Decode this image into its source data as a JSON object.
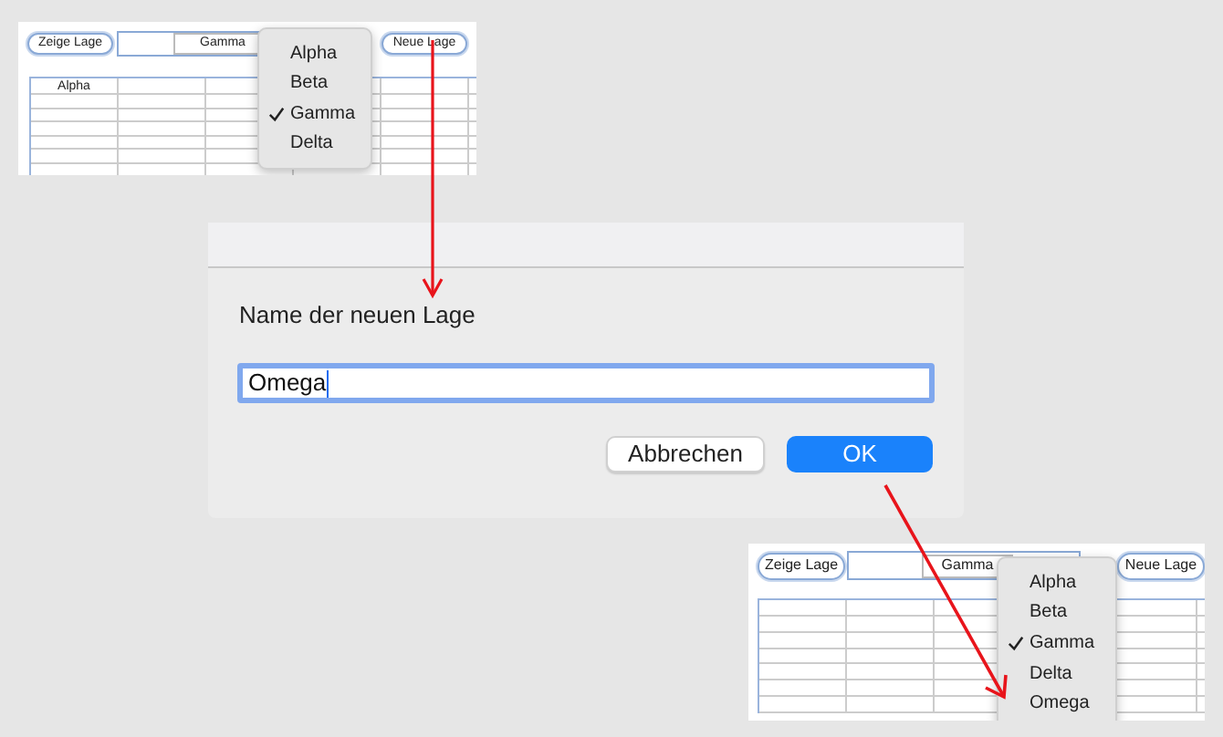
{
  "before_view": {
    "buttons": [
      "Zeige Lage",
      "Neue Lage"
    ],
    "popup": {
      "value": "Gamma"
    },
    "table": {
      "columns": [
        "Alpha"
      ]
    },
    "menu": [
      {
        "label": "Alpha",
        "selected": false
      },
      {
        "label": "Beta",
        "selected": false
      },
      {
        "label": "Gamma",
        "selected": true
      },
      {
        "label": "Delta",
        "selected": false
      }
    ]
  },
  "dialog": {
    "prompt": "Name der neuen Lage",
    "field": {
      "value": "Omega",
      "focused": true
    },
    "buttons": [
      {
        "label": "Abbrechen",
        "kind": "cancel"
      },
      {
        "label": "OK",
        "kind": "default"
      }
    ]
  },
  "after_view": {
    "buttons": [
      "Zeige Lage",
      "Neue Lage"
    ],
    "popup": {
      "value": "Gamma"
    },
    "menu": [
      {
        "label": "Alpha",
        "selected": false
      },
      {
        "label": "Beta",
        "selected": false
      },
      {
        "label": "Gamma",
        "selected": true
      },
      {
        "label": "Delta",
        "selected": false
      },
      {
        "label": "Omega",
        "selected": false
      }
    ]
  }
}
